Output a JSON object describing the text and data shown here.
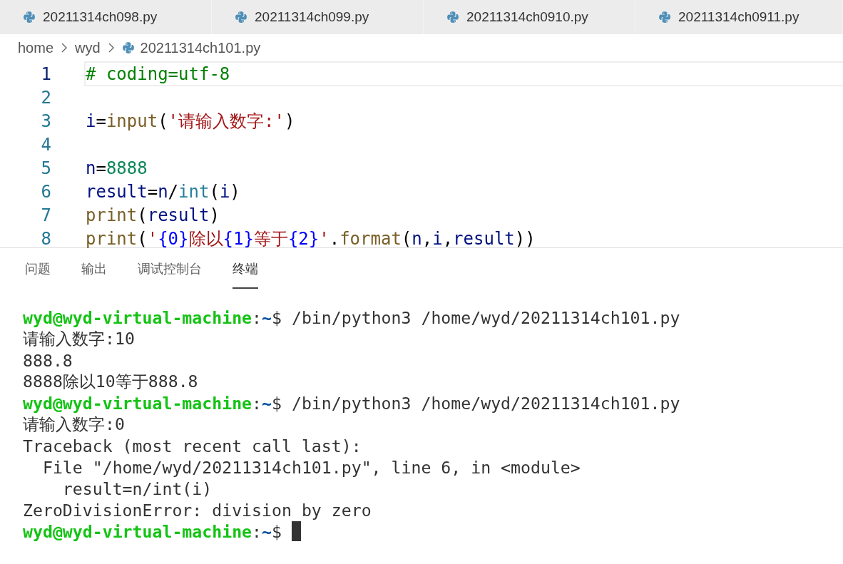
{
  "editor_tabs": [
    {
      "label": "20211314ch098.py",
      "selected": false
    },
    {
      "label": "20211314ch099.py",
      "selected": false
    },
    {
      "label": "20211314ch0910.py",
      "selected": false
    },
    {
      "label": "20211314ch0911.py",
      "selected": false
    }
  ],
  "breadcrumb": {
    "folders": [
      "home",
      "wyd"
    ],
    "file": "20211314ch101.py"
  },
  "code_lines": [
    {
      "number": "1",
      "current": true,
      "tokens": [
        {
          "kind": "comment",
          "text": "# coding=utf-8"
        }
      ]
    },
    {
      "number": "2",
      "current": false
    },
    {
      "number": "3",
      "current": false,
      "tokens": [
        {
          "kind": "var",
          "text": "i"
        },
        {
          "kind": "op",
          "text": "="
        },
        {
          "kind": "func",
          "text": "input"
        },
        {
          "kind": "op",
          "text": "("
        },
        {
          "kind": "str",
          "text": "'请输入数字:'"
        },
        {
          "kind": "op",
          "text": ")"
        }
      ]
    },
    {
      "number": "4",
      "current": false
    },
    {
      "number": "5",
      "current": false,
      "tokens": [
        {
          "kind": "var",
          "text": "n"
        },
        {
          "kind": "op",
          "text": "="
        },
        {
          "kind": "num",
          "text": "8888"
        }
      ]
    },
    {
      "number": "6",
      "current": false,
      "tokens": [
        {
          "kind": "var",
          "text": "result"
        },
        {
          "kind": "op",
          "text": "="
        },
        {
          "kind": "var",
          "text": "n"
        },
        {
          "kind": "op",
          "text": "/"
        },
        {
          "kind": "builtin",
          "text": "int"
        },
        {
          "kind": "op",
          "text": "("
        },
        {
          "kind": "var",
          "text": "i"
        },
        {
          "kind": "op",
          "text": ")"
        }
      ]
    },
    {
      "number": "7",
      "current": false,
      "tokens": [
        {
          "kind": "func",
          "text": "print"
        },
        {
          "kind": "op",
          "text": "("
        },
        {
          "kind": "var",
          "text": "result"
        },
        {
          "kind": "op",
          "text": ")"
        }
      ]
    },
    {
      "number": "8",
      "current": false,
      "tokens": [
        {
          "kind": "func",
          "text": "print"
        },
        {
          "kind": "op",
          "text": "("
        },
        {
          "kind": "str",
          "text": "'"
        },
        {
          "kind": "fmt",
          "text": "{0}"
        },
        {
          "kind": "str",
          "text": "除以"
        },
        {
          "kind": "fmt",
          "text": "{1}"
        },
        {
          "kind": "str",
          "text": "等于"
        },
        {
          "kind": "fmt",
          "text": "{2}"
        },
        {
          "kind": "str",
          "text": "'"
        },
        {
          "kind": "op",
          "text": "."
        },
        {
          "kind": "func",
          "text": "format"
        },
        {
          "kind": "op",
          "text": "("
        },
        {
          "kind": "var",
          "text": "n"
        },
        {
          "kind": "op",
          "text": ","
        },
        {
          "kind": "var",
          "text": "i"
        },
        {
          "kind": "op",
          "text": ","
        },
        {
          "kind": "var",
          "text": "result"
        },
        {
          "kind": "op",
          "text": "))"
        }
      ]
    }
  ],
  "panel_tabs": [
    {
      "label": "问题",
      "selected": false
    },
    {
      "label": "输出",
      "selected": false
    },
    {
      "label": "调试控制台",
      "selected": false
    },
    {
      "label": "终端",
      "selected": true
    }
  ],
  "terminal_lines": [
    {
      "cursor": false,
      "tokens": [
        {
          "kind": "user",
          "text": "wyd@wyd-virtual-machine"
        },
        {
          "kind": "sep",
          "text": ":"
        },
        {
          "kind": "path",
          "text": "~"
        },
        {
          "kind": "text",
          "text": "$ /bin/python3 /home/wyd/20211314ch101.py"
        }
      ]
    },
    {
      "cursor": false,
      "tokens": [
        {
          "kind": "text",
          "text": "请输入数字:10"
        }
      ]
    },
    {
      "cursor": false,
      "tokens": [
        {
          "kind": "text",
          "text": "888.8"
        }
      ]
    },
    {
      "cursor": false,
      "tokens": [
        {
          "kind": "text",
          "text": "8888除以10等于888.8"
        }
      ]
    },
    {
      "cursor": false,
      "tokens": [
        {
          "kind": "user",
          "text": "wyd@wyd-virtual-machine"
        },
        {
          "kind": "sep",
          "text": ":"
        },
        {
          "kind": "path",
          "text": "~"
        },
        {
          "kind": "text",
          "text": "$ /bin/python3 /home/wyd/20211314ch101.py"
        }
      ]
    },
    {
      "cursor": false,
      "tokens": [
        {
          "kind": "text",
          "text": "请输入数字:0"
        }
      ]
    },
    {
      "cursor": false,
      "tokens": [
        {
          "kind": "text",
          "text": "Traceback (most recent call last):"
        }
      ]
    },
    {
      "cursor": false,
      "tokens": [
        {
          "kind": "text",
          "text": "  File \"/home/wyd/20211314ch101.py\", line 6, in <module>"
        }
      ]
    },
    {
      "cursor": false,
      "tokens": [
        {
          "kind": "text",
          "text": "    result=n/int(i)"
        }
      ]
    },
    {
      "cursor": false,
      "tokens": [
        {
          "kind": "text",
          "text": "ZeroDivisionError: division by zero"
        }
      ]
    },
    {
      "cursor": true,
      "tokens": [
        {
          "kind": "user",
          "text": "wyd@wyd-virtual-machine"
        },
        {
          "kind": "sep",
          "text": ":"
        },
        {
          "kind": "path",
          "text": "~"
        },
        {
          "kind": "text",
          "text": "$ "
        }
      ]
    }
  ]
}
